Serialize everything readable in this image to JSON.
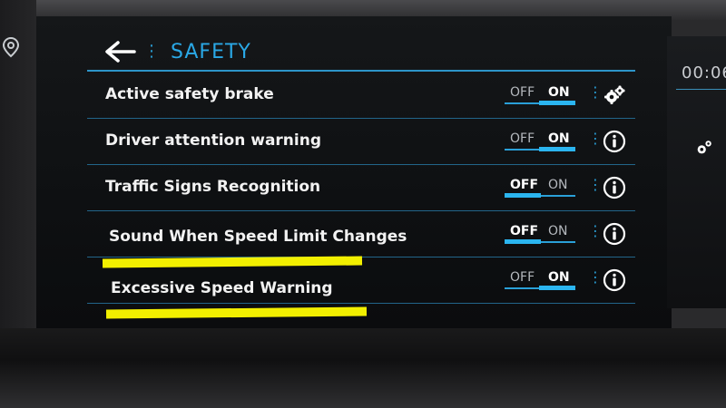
{
  "header": {
    "title": "SAFETY"
  },
  "clock": {
    "time": "00:06"
  },
  "toggle_labels": {
    "off": "OFF",
    "on": "ON"
  },
  "rows": [
    {
      "label": "Active safety brake",
      "state": "on",
      "action_icon": "gear-icon"
    },
    {
      "label": "Driver attention warning",
      "state": "on",
      "action_icon": "info-icon"
    },
    {
      "label": "Traffic Signs Recognition",
      "state": "off",
      "action_icon": "info-icon"
    },
    {
      "label": "Sound When Speed Limit Changes",
      "state": "off",
      "action_icon": "info-icon"
    },
    {
      "label": "Excessive Speed Warning",
      "state": "on",
      "action_icon": "info-icon"
    }
  ],
  "colors": {
    "accent": "#2aa8e6",
    "background": "#0e1012",
    "highlight": "#f2ef00"
  }
}
